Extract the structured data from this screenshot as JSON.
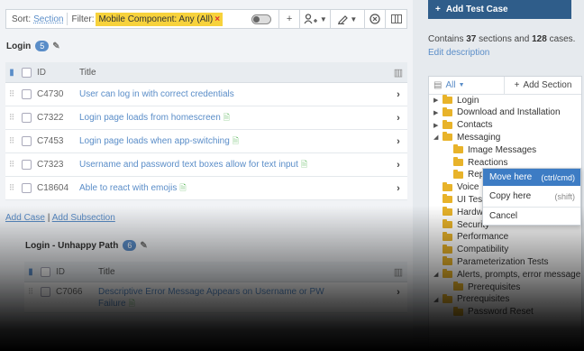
{
  "filter_bar": {
    "sort_label": "Sort:",
    "sort_value": "Section",
    "filter_label": "Filter:",
    "filter_chip": "Mobile Component: Any (All)",
    "chip_close": "×",
    "add_icon": "+",
    "assign_icon": "user-plus",
    "edit_icon": "pencil",
    "clear_icon": "x-circle",
    "columns_icon": "columns"
  },
  "sections": [
    {
      "title": "Login",
      "count": "5",
      "columns": {
        "id": "ID",
        "title": "Title"
      },
      "rows": [
        {
          "id": "C4730",
          "title": "User can log in with correct credentials",
          "has_doc": false
        },
        {
          "id": "C7322",
          "title": "Login page loads from homescreen",
          "has_doc": true
        },
        {
          "id": "C7453",
          "title": "Login page loads when app-switching",
          "has_doc": true
        },
        {
          "id": "C7323",
          "title": "Username and password text boxes allow for text input",
          "has_doc": true
        },
        {
          "id": "C18604",
          "title": "Able to react with emojis",
          "has_doc": true
        }
      ]
    },
    {
      "title": "Login - Unhappy Path",
      "count": "6",
      "columns": {
        "id": "ID",
        "title": "Title"
      },
      "rows": [
        {
          "id": "C7066",
          "title": "Descriptive Error Message Appears on Username or PW",
          "title_line2": "Failure",
          "has_doc": true
        }
      ]
    }
  ],
  "links": {
    "add_case": "Add Case",
    "separator": "|",
    "add_subsection": "Add Subsection"
  },
  "sidebar": {
    "add_test_case": "Add Test Case",
    "contains_prefix": "Contains",
    "sections_count": "37",
    "sections_word": "sections and",
    "cases_count": "128",
    "cases_word": "cases.",
    "edit_description": "Edit description",
    "tree_filter": "All",
    "add_section": "Add Section",
    "tree": [
      {
        "label": "Login",
        "level": 0,
        "arrow": "▶"
      },
      {
        "label": "Download and Installation",
        "level": 0,
        "arrow": "▶"
      },
      {
        "label": "Contacts",
        "level": 0,
        "arrow": "▶"
      },
      {
        "label": "Messaging",
        "level": 0,
        "arrow": "◢"
      },
      {
        "label": "Image Messages",
        "level": 1,
        "arrow": ""
      },
      {
        "label": "Reactions",
        "level": 1,
        "arrow": ""
      },
      {
        "label": "Rep",
        "level": 1,
        "arrow": ""
      },
      {
        "label": "Voice N",
        "level": 0,
        "arrow": ""
      },
      {
        "label": "UI Test",
        "level": 0,
        "arrow": ""
      },
      {
        "label": "Hardw",
        "level": 0,
        "arrow": ""
      },
      {
        "label": "Security",
        "level": 0,
        "arrow": ""
      },
      {
        "label": "Performance",
        "level": 0,
        "arrow": ""
      },
      {
        "label": "Compatibility",
        "level": 0,
        "arrow": ""
      },
      {
        "label": "Parameterization Tests",
        "level": 0,
        "arrow": ""
      },
      {
        "label": "Alerts, prompts, error message",
        "level": 0,
        "arrow": "◢"
      },
      {
        "label": "Prerequisites",
        "level": 1,
        "arrow": ""
      },
      {
        "label": "Prerequisites",
        "level": 0,
        "arrow": "◢"
      },
      {
        "label": "Password Reset",
        "level": 1,
        "arrow": ""
      }
    ]
  },
  "context_menu": {
    "items": [
      {
        "label": "Move here",
        "hint": "(ctrl/cmd)",
        "active": true
      },
      {
        "label": "Copy here",
        "hint": "(shift)",
        "active": false
      },
      {
        "label": "Cancel",
        "hint": "",
        "active": false
      }
    ]
  },
  "colors": {
    "accent": "#5a8dc8",
    "primary_button": "#2f5d8a",
    "chip": "#f7d23c",
    "folder": "#e8b32a",
    "menu_active": "#3d7cc4"
  }
}
